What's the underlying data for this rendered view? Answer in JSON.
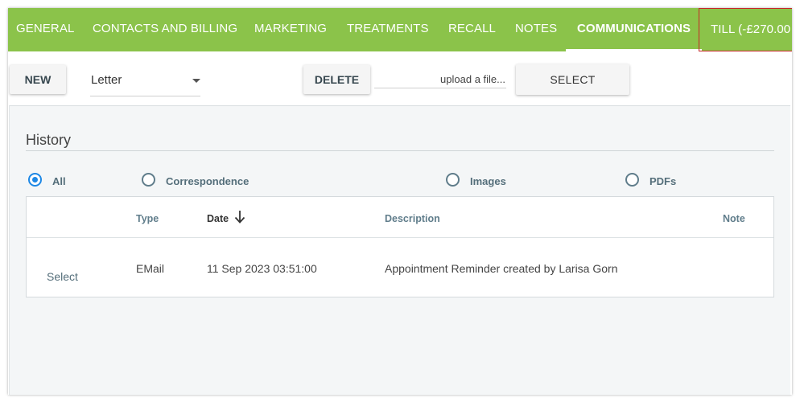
{
  "tabs": [
    {
      "label": "GENERAL"
    },
    {
      "label": "CONTACTS AND BILLING"
    },
    {
      "label": "MARKETING"
    },
    {
      "label": "TREATMENTS"
    },
    {
      "label": "RECALL"
    },
    {
      "label": "NOTES"
    },
    {
      "label": "COMMUNICATIONS",
      "active": true
    },
    {
      "label": "TILL (-£270.00"
    }
  ],
  "toolbar": {
    "new_label": "NEW",
    "letter_type": "Letter",
    "delete_label": "DELETE",
    "upload_placeholder": "upload a file...",
    "select_label": "SELECT"
  },
  "history": {
    "title": "History",
    "filters": [
      {
        "label": "All",
        "checked": true
      },
      {
        "label": "Correspondence",
        "checked": false
      },
      {
        "label": "Images",
        "checked": false
      },
      {
        "label": "PDFs",
        "checked": false
      }
    ],
    "columns": {
      "type": "Type",
      "date": "Date",
      "description": "Description",
      "note": "Note"
    },
    "rows": [
      {
        "action": "Select",
        "type": "EMail",
        "date": "11 Sep 2023 03:51:00",
        "description": "Appointment Reminder created by Larisa Gorn",
        "note": ""
      }
    ]
  },
  "colors": {
    "tab_bar": "#8bc34a",
    "radio_active": "#1e88e5",
    "till_border": "#c62828"
  }
}
